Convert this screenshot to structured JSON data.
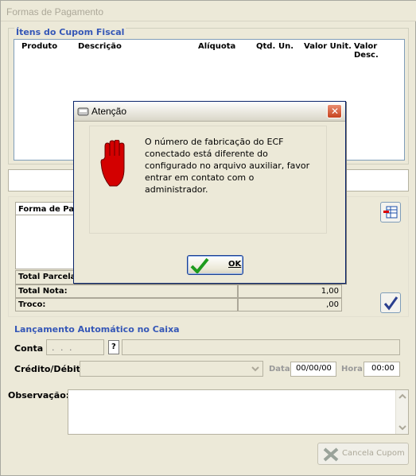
{
  "window": {
    "title": "Formas de Pagamento"
  },
  "items_group": {
    "title": "Ítens do Cupom Fiscal",
    "columns": [
      "Produto",
      "Descrição",
      "Alíquota",
      "Qtd.",
      "Un.",
      "Valor Unit.",
      "Valor Desc."
    ]
  },
  "payment": {
    "header": "Forma de Pag",
    "total_parcelas_label": "Total Parcela",
    "total_nota_label": "Total Nota:",
    "total_nota_value": "1,00",
    "troco_label": "Troco:",
    "troco_value": ",00"
  },
  "lancamento": {
    "title": "Lançamento Automático no Caixa",
    "conta_label": "Conta",
    "conta_value": ". . .",
    "conta_btn": "?",
    "credito_label": "Crédito/Débito:",
    "data_label": "Data:",
    "data_value": "00/00/00",
    "hora_label": "Hora",
    "hora_value": "00:00"
  },
  "observacao": {
    "label": "Observação:"
  },
  "buttons": {
    "cancela_cupom": "Cancela Cupom"
  },
  "dialog": {
    "title": "Atenção",
    "close": "✕",
    "message": "O número de fabricação do ECF conectado está diferente do configurado no arquivo auxiliar, favor entrar em contato com o administrador.",
    "ok": "OK"
  }
}
